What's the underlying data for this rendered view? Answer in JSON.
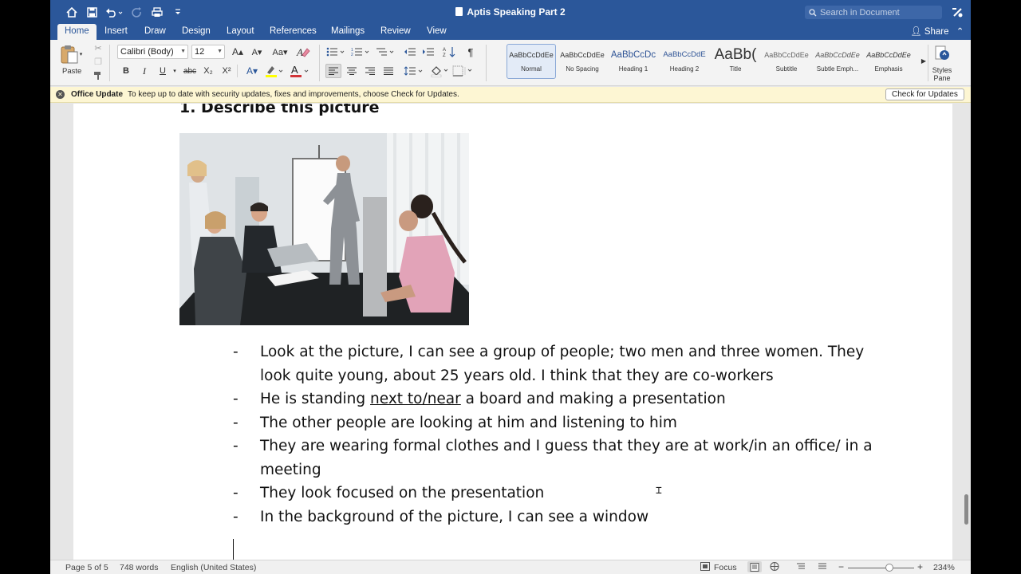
{
  "window": {
    "title": "Aptis Speaking Part 2",
    "search_placeholder": "Search in Document",
    "share_label": "Share"
  },
  "tabs": [
    {
      "label": "Home",
      "active": true
    },
    {
      "label": "Insert"
    },
    {
      "label": "Draw"
    },
    {
      "label": "Design"
    },
    {
      "label": "Layout"
    },
    {
      "label": "References"
    },
    {
      "label": "Mailings"
    },
    {
      "label": "Review"
    },
    {
      "label": "View"
    }
  ],
  "ribbon": {
    "paste_label": "Paste",
    "font_name": "Calibri (Body)",
    "font_size": "12",
    "bold": "B",
    "italic": "I",
    "underline": "U",
    "strike": "abc",
    "styles": [
      {
        "sample": "AaBbCcDdEe",
        "name": "Normal",
        "active": true
      },
      {
        "sample": "AaBbCcDdEe",
        "name": "No Spacing"
      },
      {
        "sample": "AaBbCcDc",
        "name": "Heading 1"
      },
      {
        "sample": "AaBbCcDdE",
        "name": "Heading 2"
      },
      {
        "sample": "AaBb(",
        "name": "Title"
      },
      {
        "sample": "AaBbCcDdEe",
        "name": "Subtitle"
      },
      {
        "sample": "AaBbCcDdEe",
        "name": "Subtle Emph..."
      },
      {
        "sample": "AaBbCcDdEe",
        "name": "Emphasis"
      }
    ],
    "styles_pane_label": "Styles Pane"
  },
  "update_bar": {
    "title": "Office Update",
    "message": "To keep up to date with security updates, fixes and improvements, choose Check for Updates.",
    "button": "Check for Updates"
  },
  "document": {
    "heading": "1. Describe this picture",
    "bullets": [
      {
        "dash": "-",
        "text": "Look at the picture, I can see a group of people; two men and three women. They look quite young, about 25 years old. I think that they are co-workers"
      },
      {
        "dash": "-",
        "pre": "He is standing ",
        "underlined": "next to/near",
        "post": " a board and making a presentation"
      },
      {
        "dash": "-",
        "text": "The other people are looking at him and listening to him"
      },
      {
        "dash": "-",
        "text": "They are wearing formal clothes and I guess that they are at work/in an office/ in a meeting"
      },
      {
        "dash": "-",
        "text": "They look focused on the presentation"
      },
      {
        "dash": "-",
        "text": "In the background of the picture, I can see a window"
      }
    ]
  },
  "status": {
    "page": "Page 5 of 5",
    "words": "748 words",
    "language": "English (United States)",
    "focus": "Focus",
    "zoom": "234%"
  },
  "colors": {
    "accent": "#2b579a",
    "font_color_swatch": "#d13438",
    "highlight_swatch": "#ffff00"
  }
}
